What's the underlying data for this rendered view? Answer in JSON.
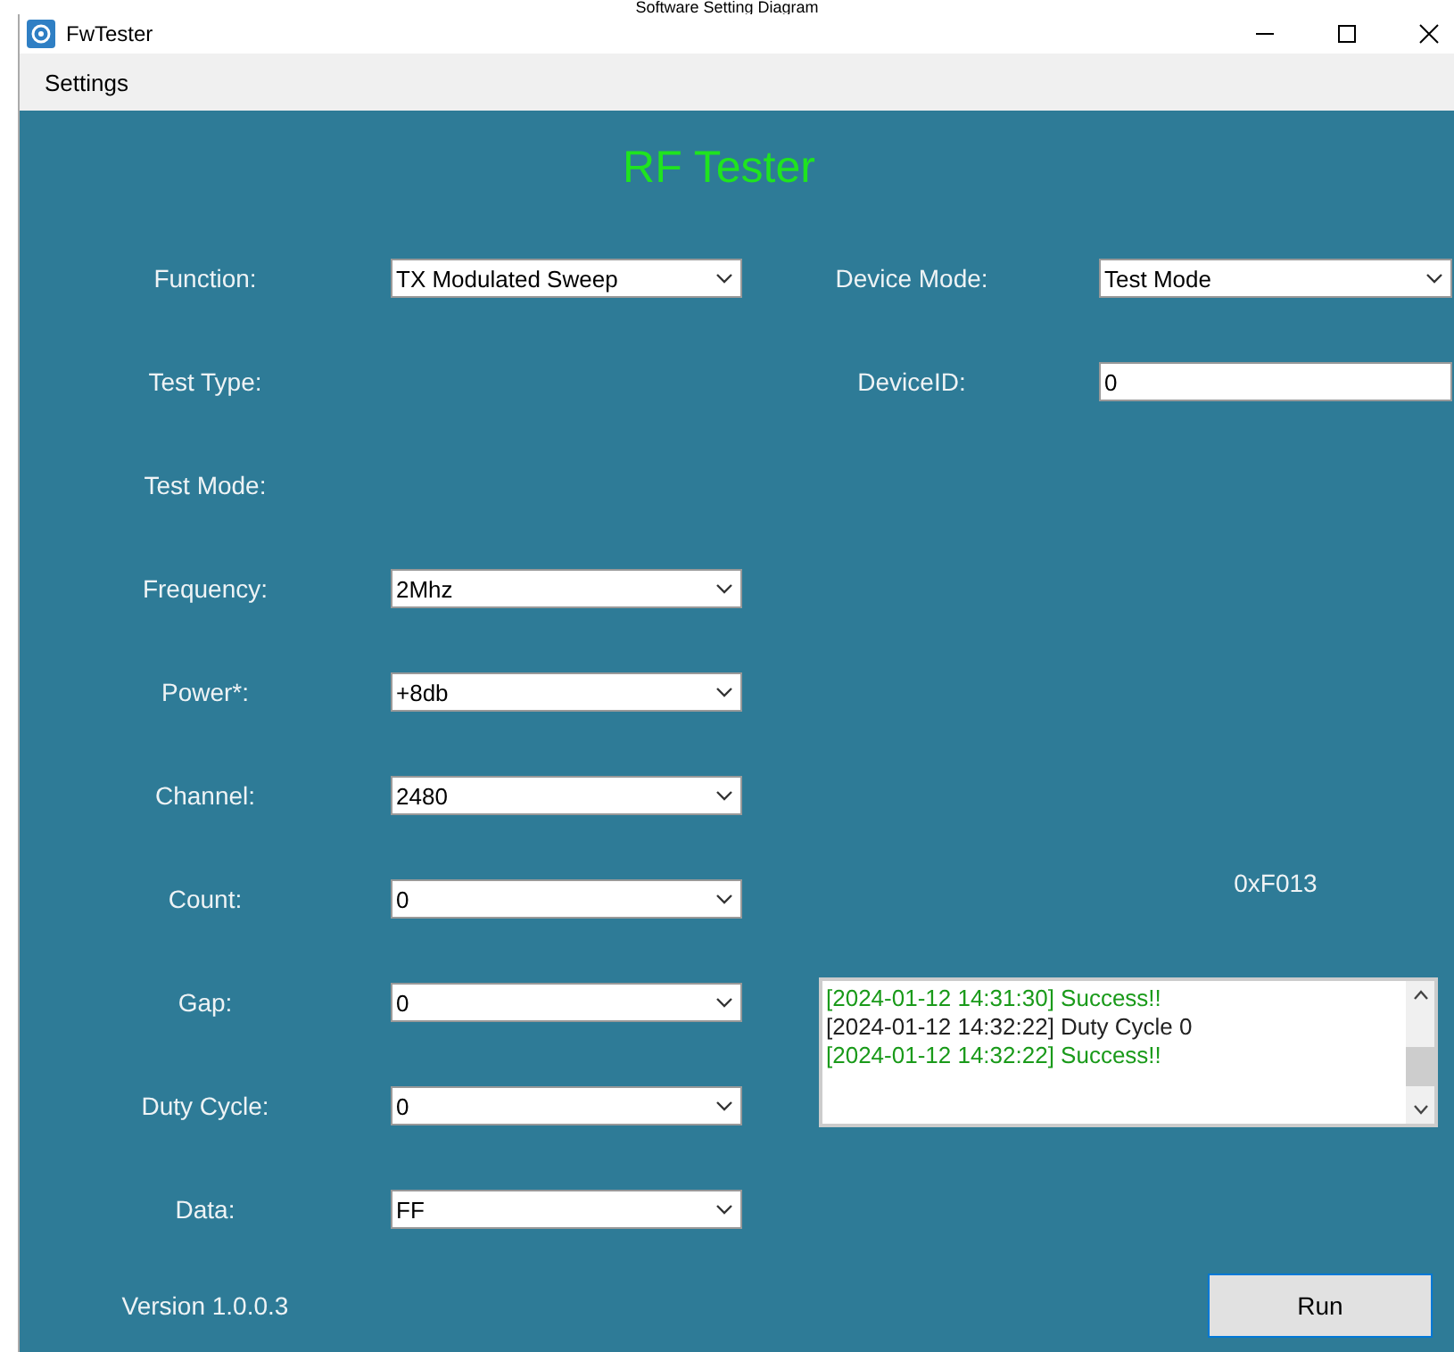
{
  "caption": "Software Setting Diagram",
  "window": {
    "title": "FwTester"
  },
  "menu": [
    "Settings"
  ],
  "heading": "RF Tester",
  "fields": [
    {
      "label": "Function:",
      "kind": "combo",
      "value": "TX Modulated Sweep"
    },
    {
      "label": "Test Type:",
      "kind": "none"
    },
    {
      "label": "Test Mode:",
      "kind": "none"
    },
    {
      "label": "Frequency:",
      "kind": "combo",
      "value": "2Mhz"
    },
    {
      "label": "Power*:",
      "kind": "combo",
      "value": "+8db"
    },
    {
      "label": "Channel:",
      "kind": "combo",
      "value": "2480"
    },
    {
      "label": "Count:",
      "kind": "combo",
      "value": "0"
    },
    {
      "label": "Gap:",
      "kind": "combo",
      "value": "0"
    },
    {
      "label": "Duty Cycle:",
      "kind": "combo",
      "value": "0"
    },
    {
      "label": "Data:",
      "kind": "combo",
      "value": "FF"
    }
  ],
  "device_fields": [
    {
      "label": "Device Mode:",
      "kind": "combo",
      "value": "Test Mode"
    },
    {
      "label": "DeviceID:",
      "kind": "input",
      "value": "0"
    }
  ],
  "device_code": "0xF013",
  "log": [
    {
      "text": "[2024-01-12 14:31:30] Success!!",
      "kind": "success"
    },
    {
      "text": "[2024-01-12 14:32:22] Duty Cycle 0",
      "kind": "info"
    },
    {
      "text": "[2024-01-12 14:32:22] Success!!",
      "kind": "success"
    }
  ],
  "version": "Version 1.0.0.3",
  "run_button": "Run"
}
